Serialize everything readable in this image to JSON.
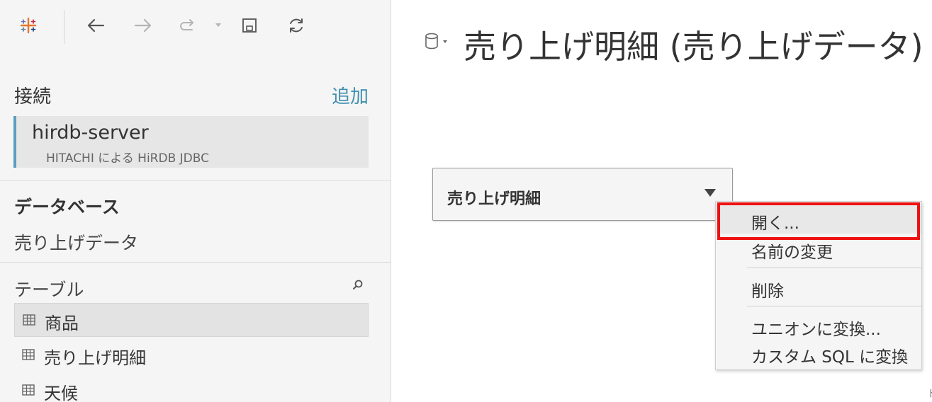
{
  "toolbar": {
    "logo_icon": "tableau-logo-icon",
    "back_icon": "back-arrow-icon",
    "forward_icon": "forward-arrow-icon",
    "redo_icon": "redo-icon",
    "save_icon": "save-icon",
    "refresh_icon": "refresh-icon"
  },
  "connections": {
    "label": "接続",
    "add_label": "追加",
    "items": [
      {
        "name": "hirdb-server",
        "driver": "HITACHI による HiRDB JDBC"
      }
    ]
  },
  "database": {
    "label": "データベース",
    "value": "売り上げデータ"
  },
  "tables": {
    "label": "テーブル",
    "items": [
      {
        "label": "商品",
        "selected": true
      },
      {
        "label": "売り上げ明細",
        "selected": false
      },
      {
        "label": "天候",
        "selected": false
      }
    ]
  },
  "canvas": {
    "title": "売り上げ明細 (売り上げデータ)",
    "table_box_label": "売り上げ明細"
  },
  "context_menu": {
    "items": [
      {
        "label": "開く...",
        "highlighted": true
      },
      {
        "label": "名前の変更"
      },
      {
        "label": "削除"
      },
      {
        "label": "ユニオンに変換..."
      },
      {
        "label": "カスタム SQL に変換"
      }
    ]
  },
  "colors": {
    "accent": "#3e8fb0",
    "connection_bar": "#5b9ec1",
    "highlight_box": "#ee1111"
  }
}
